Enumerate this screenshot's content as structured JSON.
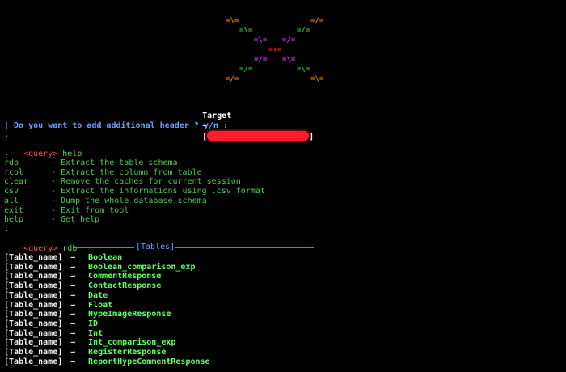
{
  "ascii_art": {
    "glyphs": [
      {
        "text": "=\\=",
        "color": "#ff8a00"
      },
      {
        "text": "=/=",
        "color": "#ff8a00"
      },
      {
        "text": "=\\=",
        "color": "#2ecc40"
      },
      {
        "text": "=/=",
        "color": "#2ecc40"
      },
      {
        "text": "=\\=",
        "color": "#d63cff"
      },
      {
        "text": "=/=",
        "color": "#d63cff"
      },
      {
        "text": "=+=",
        "color": "#ff2a2a"
      },
      {
        "text": "=/=",
        "color": "#d63cff"
      },
      {
        "text": "=\\=",
        "color": "#d63cff"
      },
      {
        "text": "=/=",
        "color": "#2ecc40"
      },
      {
        "text": "=\\=",
        "color": "#2ecc40"
      },
      {
        "text": "=/=",
        "color": "#ff8a00"
      },
      {
        "text": "=\\=",
        "color": "#ff8a00"
      }
    ]
  },
  "target": {
    "label": "Target",
    "arrow": "→",
    "open": "[",
    "close": "]"
  },
  "question": {
    "text": "| Do you want to add additional header ? y/n :"
  },
  "dot": ".",
  "prompt_tag": "<query>",
  "commands": {
    "first": "help",
    "second": "rdb"
  },
  "help_items": [
    {
      "cmd": "rdb",
      "desc": "- Extract the table schema"
    },
    {
      "cmd": "rcol",
      "desc": "- Extract the column from table"
    },
    {
      "cmd": "clear",
      "desc": "- Remove the caches for current session"
    },
    {
      "cmd": "csv",
      "desc": "- Extract the informations using .csv format"
    },
    {
      "cmd": "all",
      "desc": "- Dump the whole database schema"
    },
    {
      "cmd": "exit",
      "desc": "- Exit from tool"
    },
    {
      "cmd": "help",
      "desc": "- Get help"
    }
  ],
  "tables_header": "[Tables]",
  "table_prefix": "[Table_name]",
  "table_arrow": "→",
  "tables": [
    "Boolean",
    "Boolean_comparison_exp",
    "CommentResponse",
    "ContactResponse",
    "Date",
    "Float",
    "HypeImageResponse",
    "ID",
    "Int",
    "Int_comparison_exp",
    "RegisterResponse",
    "ReportHypeCommentResponse"
  ],
  "colors": {
    "background": "#000000",
    "green": "#4ec94e",
    "prompt_red": "#ff4b4b",
    "question_blue": "#6a9fff",
    "rule_blue": "#4d7dff",
    "redaction": "#ff1d2e"
  }
}
